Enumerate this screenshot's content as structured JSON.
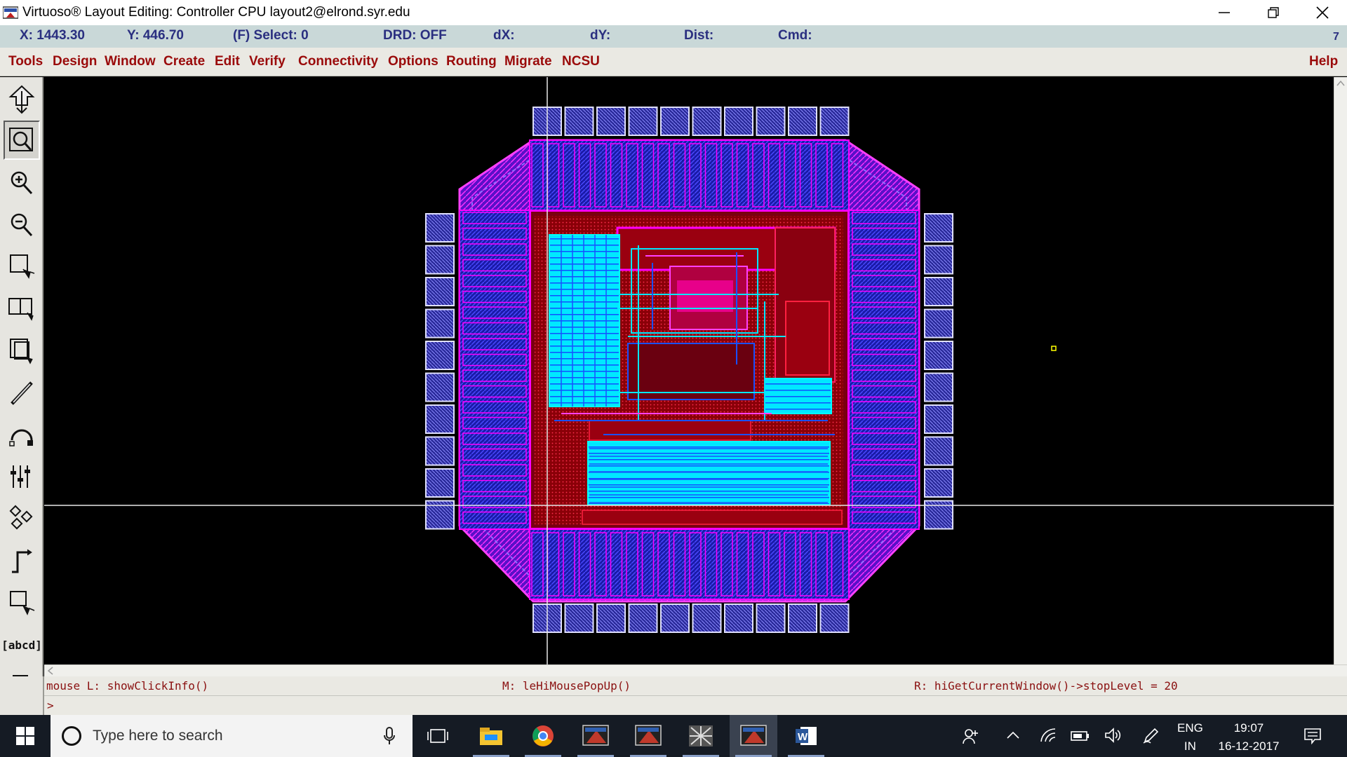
{
  "window": {
    "title": "Virtuoso® Layout Editing: Controller CPU layout2@elrond.syr.edu",
    "minimize_icon": "minimize-icon",
    "maximize_icon": "restore-icon",
    "close_icon": "close-icon"
  },
  "status": {
    "x": "X: 1443.30",
    "y": "Y: 446.70",
    "select": "(F) Select: 0",
    "drd": "DRD: OFF",
    "dx": "dX:",
    "dy": "dY:",
    "dist": "Dist:",
    "cmd": "Cmd:",
    "counter": "7"
  },
  "menu": {
    "items": [
      "Tools",
      "Design",
      "Window",
      "Create",
      "Edit",
      "Verify",
      "Connectivity",
      "Options",
      "Routing",
      "Migrate",
      "NCSU"
    ],
    "help": "Help"
  },
  "toolbar": {
    "tools": [
      "save-icon",
      "zoom-fit-icon",
      "zoom-in-icon",
      "zoom-out-icon",
      "stretch-icon",
      "copy-icon",
      "move-icon",
      "delete-icon",
      "undo-icon",
      "property-icon",
      "create-instance-icon",
      "create-path-icon",
      "create-rectangle-icon",
      "create-label-icon",
      "create-polygon-icon"
    ],
    "label_tool_text": "[abcd]"
  },
  "mouse_hints": {
    "left": "mouse L: showClickInfo()",
    "middle": "M: leHiMousePopUp()",
    "right": "R: hiGetCurrentWindow()->stopLevel = 20"
  },
  "command_line": {
    "prompt": ">"
  },
  "colors": {
    "metal1": "#1a3cff",
    "metal2": "#ff00ff",
    "poly": "#ff2244",
    "active": "#00ffff",
    "well": "#aa0000",
    "canvas": "#000000"
  },
  "taskbar": {
    "search_placeholder": "Type here to search",
    "apps": [
      "task-view-icon",
      "file-explorer-icon",
      "chrome-icon",
      "xming-icon",
      "xming-icon",
      "cadence-icon",
      "virtuoso-icon",
      "word-icon"
    ],
    "language_top": "ENG",
    "language_bottom": "IN",
    "time": "19:07",
    "date": "16-12-2017"
  }
}
